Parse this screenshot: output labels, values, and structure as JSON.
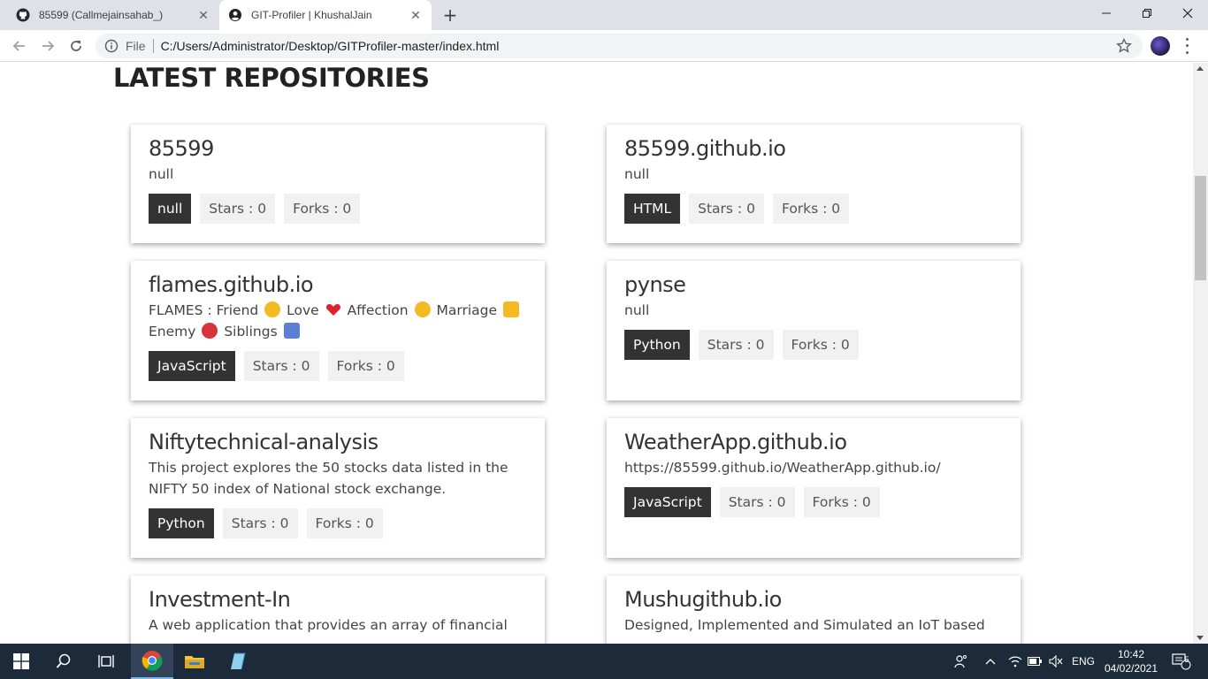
{
  "browser": {
    "tabs": [
      {
        "title": "85599 (Callmejainsahab_)",
        "icon": "github-icon",
        "active": false
      },
      {
        "title": "GIT-Profiler | KhushalJain",
        "icon": "account-icon",
        "active": true
      }
    ],
    "new_tab": "+",
    "omnibox": {
      "scheme_label": "File",
      "url": "C:/Users/Administrator/Desktop/GITProfiler-master/index.html"
    }
  },
  "page": {
    "section_title": "LATEST REPOSITORIES",
    "repos": [
      {
        "name": "85599",
        "description": "null",
        "language": "null",
        "stars": "Stars : 0",
        "forks": "Forks : 0"
      },
      {
        "name": "85599.github.io",
        "description": "null",
        "language": "HTML",
        "stars": "Stars : 0",
        "forks": "Forks : 0"
      },
      {
        "name": "flames.github.io",
        "description_parts": [
          "FLAMES : Friend",
          "Love",
          "Affection",
          "Marriage",
          "Enemy",
          "Siblings"
        ],
        "language": "JavaScript",
        "stars": "Stars : 0",
        "forks": "Forks : 0"
      },
      {
        "name": "pynse",
        "description": "null",
        "language": "Python",
        "stars": "Stars : 0",
        "forks": "Forks : 0"
      },
      {
        "name": "Niftytechnical-analysis",
        "description": "This project explores the 50 stocks data listed in the NIFTY 50 index of National stock exchange.",
        "language": "Python",
        "stars": "Stars : 0",
        "forks": "Forks : 0"
      },
      {
        "name": "WeatherApp.github.io",
        "description": "https://85599.github.io/WeatherApp.github.io/",
        "language": "JavaScript",
        "stars": "Stars : 0",
        "forks": "Forks : 0"
      },
      {
        "name": "Investment-In",
        "description": "A web application that provides an array of financial"
      },
      {
        "name": "Mushugithub.io",
        "description": "Designed, Implemented and Simulated an IoT based"
      }
    ]
  },
  "taskbar": {
    "language": "ENG",
    "time": "10:42",
    "date": "04/02/2021",
    "notifications": "5"
  },
  "colors": {
    "tag_lang_bg": "#333333",
    "tag_stat_bg": "#f1f1f1",
    "taskbar_bg": "#1c2a3a"
  }
}
